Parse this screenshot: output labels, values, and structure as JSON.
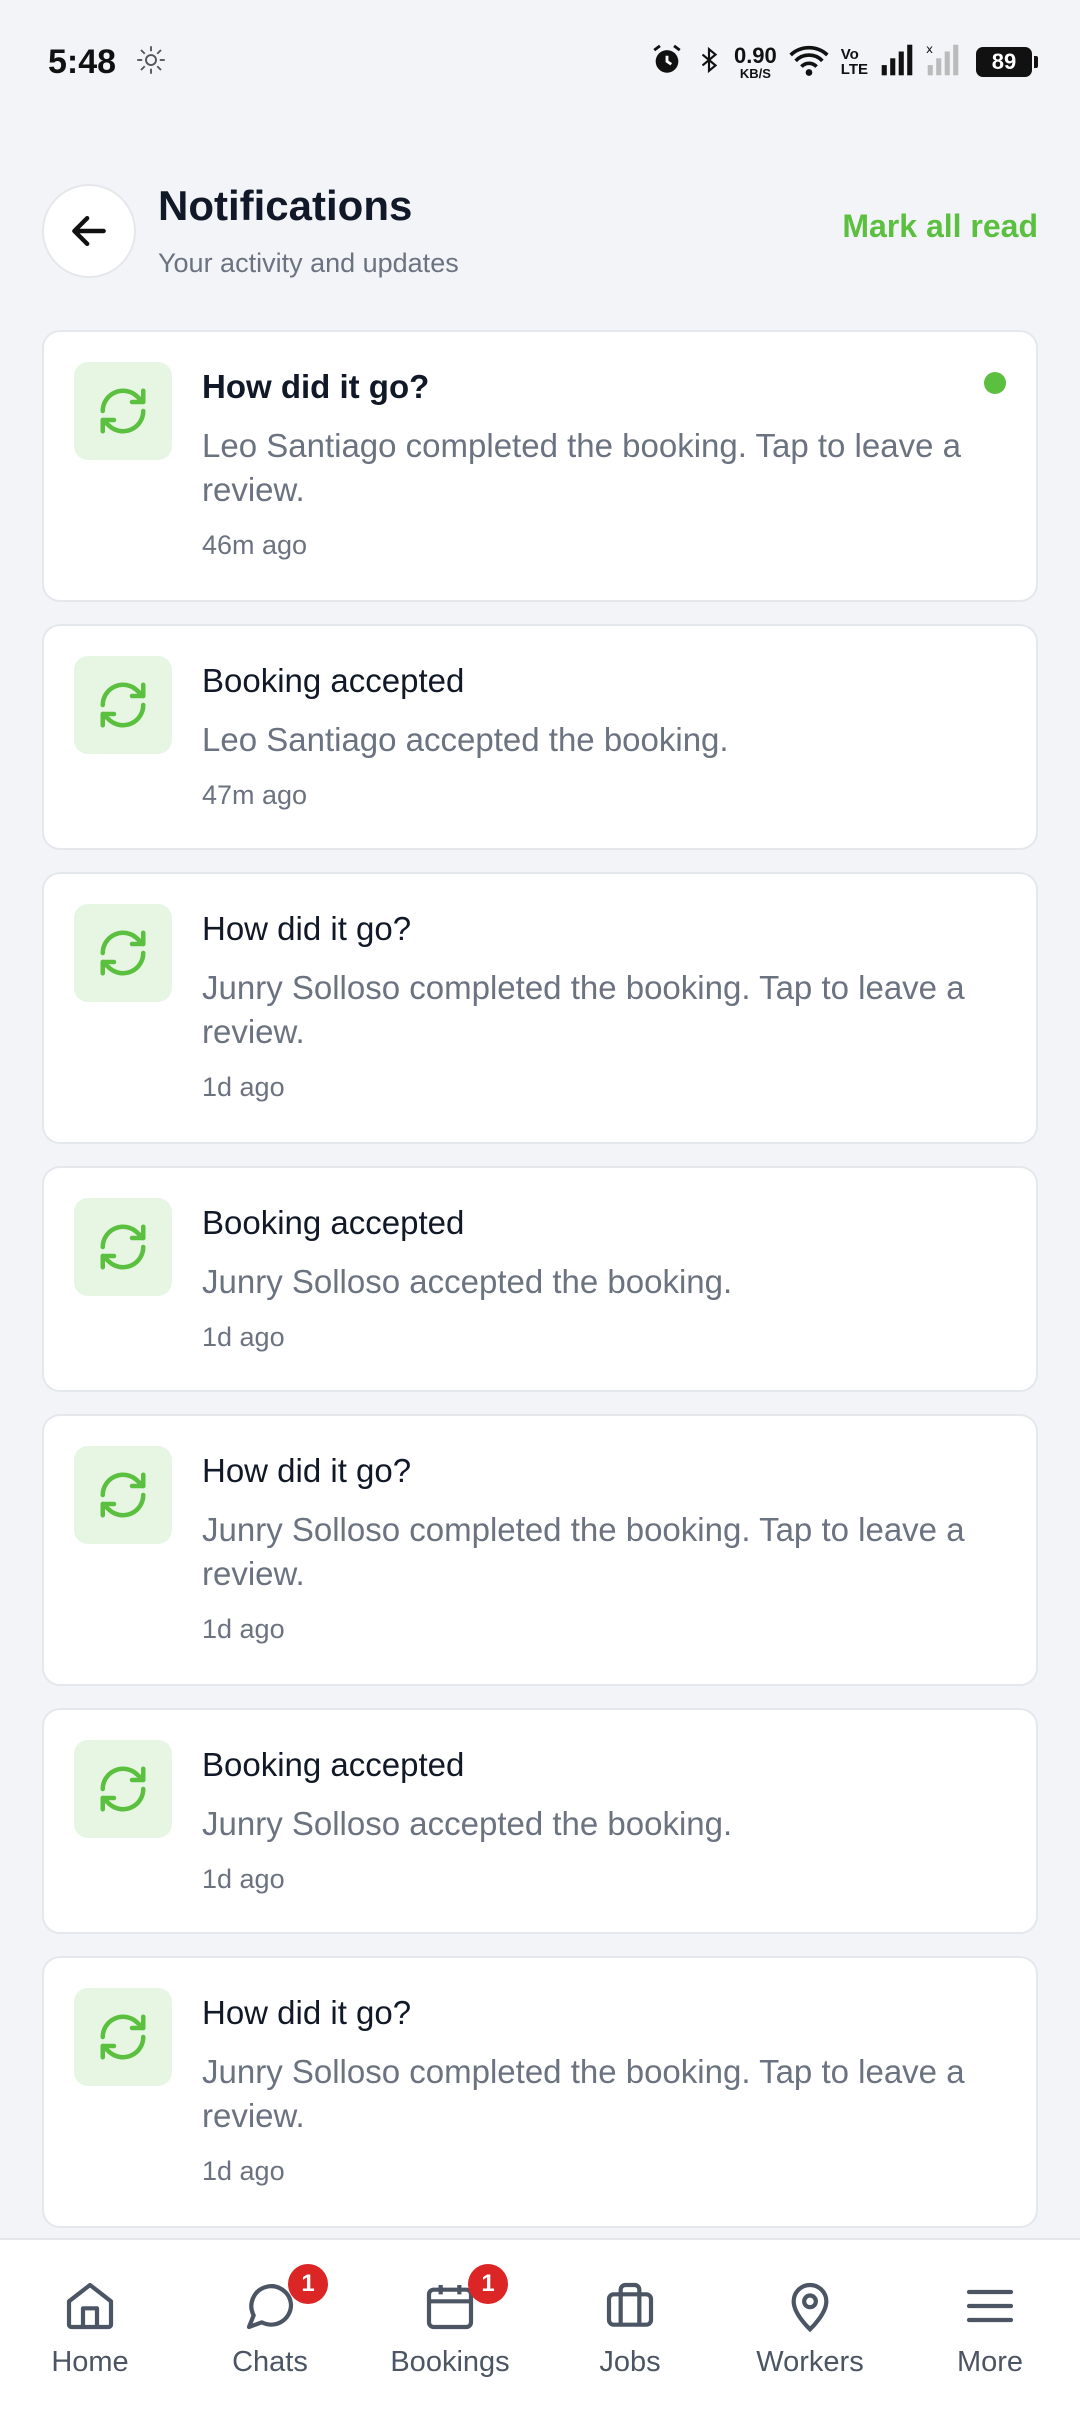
{
  "status_bar": {
    "time": "5:48",
    "speed_value": "0.90",
    "speed_unit": "KB/S",
    "volte_top": "Vo",
    "volte_bottom": "LTE",
    "battery": "89"
  },
  "header": {
    "title": "Notifications",
    "subtitle": "Your activity and updates",
    "mark_all_read": "Mark all read"
  },
  "notifications": [
    {
      "title": "How did it go?",
      "body": "Leo Santiago completed the booking. Tap to leave a review.",
      "time": "46m ago",
      "unread": true
    },
    {
      "title": "Booking accepted",
      "body": "Leo Santiago accepted the booking.",
      "time": "47m ago",
      "unread": false
    },
    {
      "title": "How did it go?",
      "body": "Junry Solloso completed the booking. Tap to leave a review.",
      "time": "1d ago",
      "unread": false
    },
    {
      "title": "Booking accepted",
      "body": "Junry Solloso accepted the booking.",
      "time": "1d ago",
      "unread": false
    },
    {
      "title": "How did it go?",
      "body": "Junry Solloso completed the booking. Tap to leave a review.",
      "time": "1d ago",
      "unread": false
    },
    {
      "title": "Booking accepted",
      "body": "Junry Solloso accepted the booking.",
      "time": "1d ago",
      "unread": false
    },
    {
      "title": "How did it go?",
      "body": "Junry Solloso completed the booking. Tap to leave a review.",
      "time": "1d ago",
      "unread": false
    }
  ],
  "nav": [
    {
      "label": "Home",
      "icon": "home-icon"
    },
    {
      "label": "Chats",
      "icon": "chat-icon",
      "badge": "1"
    },
    {
      "label": "Bookings",
      "icon": "calendar-icon",
      "badge": "1"
    },
    {
      "label": "Jobs",
      "icon": "briefcase-icon"
    },
    {
      "label": "Workers",
      "icon": "map-pin-icon"
    },
    {
      "label": "More",
      "icon": "menu-icon"
    }
  ],
  "colors": {
    "accent": "#5bbf3f",
    "icon_bg": "#e6f6e2",
    "badge": "#dc2626",
    "background": "#f3f4f8"
  }
}
